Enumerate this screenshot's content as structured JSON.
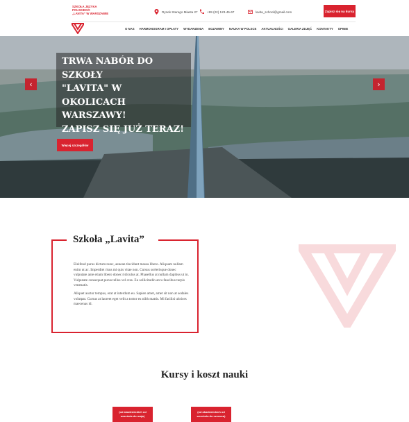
{
  "header": {
    "brand_lines": [
      "SZKOŁA JĘZYKA",
      "POLSKIEGO",
      "„LAVITA” W WARSZAWIE"
    ],
    "address": "Rynek Starego Miasta 27",
    "phone": "+99 (22) 123-45-67",
    "email": "lavita_school@gmail.com",
    "cta_label": "Zapisz się na kursy"
  },
  "nav": {
    "items": [
      "O NAS",
      "HARMONOGRAM I OPŁATY",
      "WYDARZENIA",
      "EGZAMINY",
      "NAUKA W POLSCE",
      "AKTUALNOŚCI",
      "GALERIA ZDJĘĆ",
      "KONTAKTY",
      "OPINIE"
    ]
  },
  "hero": {
    "title_lines": [
      "TRWA NABÓR DO SZKOŁY",
      "\"LAVITA\" W OKOLICACH",
      "WARSZAWY!",
      "ZAPISZ SIĘ JUŻ TERAZ!"
    ],
    "button_label": "Więcej szczegółów",
    "prev_icon": "chevron-left-icon",
    "next_icon": "chevron-right-icon"
  },
  "about": {
    "title": "Szkoła „Lavita”",
    "paragraph1": "Eleifend purus dictum nunc, aenean tincidunt massa libero. Aliquam nullam enim ut ac. Imperdiet risus mi quis vitae non. Cursus scelerisque donec vulputate ante etiam libero donec ridiculus at. Phasellus at nullam dapibus ut in. Vulputate consequat purus tellus vel cras. Eu sollicitudin arcu faucibus turpis venenatis.",
    "paragraph2": "Aliquet auctor tempus, erat at interdum eu. Sapien amet, amet sit non at sodales volutpat. Cursus at laoreet eget velit a tortor eu nibh mattis. Mi facilisi ultrices maecenas id."
  },
  "courses": {
    "title": "Kursy i koszt nauki",
    "buttons": [
      {
        "line1": "(od akademickich od",
        "line2": "września do maja)"
      },
      {
        "line1": "(od akademickich od",
        "line2": "września do czerwca)"
      }
    ]
  },
  "colors": {
    "accent": "#d9232f"
  }
}
